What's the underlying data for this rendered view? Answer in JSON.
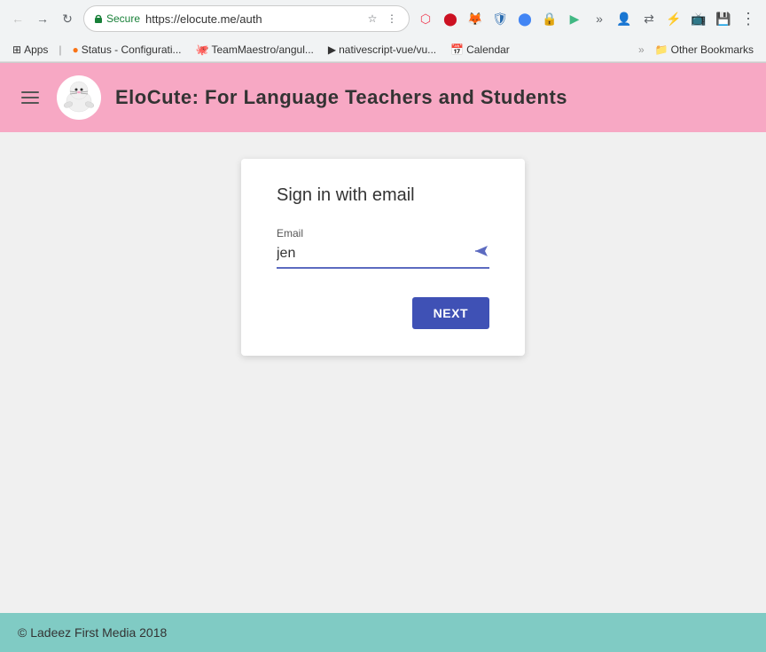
{
  "browser": {
    "url": "https://elocute.me/auth",
    "secure_label": "Secure",
    "bookmarks": [
      {
        "label": "Apps",
        "icon": "⊞"
      },
      {
        "label": "Status - Configurati...",
        "icon": "●"
      },
      {
        "label": "TeamMaestro/angul...",
        "icon": "🐙"
      },
      {
        "label": "nativescript-vue/vu...",
        "icon": "▶"
      },
      {
        "label": "Calendar",
        "icon": "📅"
      }
    ],
    "other_bookmarks_label": "Other Bookmarks"
  },
  "header": {
    "title": "EloCute: For Language Teachers and Students",
    "logo_alt": "EloCute Seal Logo",
    "menu_icon": "menu"
  },
  "signin": {
    "title": "Sign in with email",
    "email_label": "Email",
    "email_value": "jen",
    "email_placeholder": "",
    "next_button_label": "NEXT"
  },
  "footer": {
    "text": "© Ladeez First Media 2018"
  }
}
